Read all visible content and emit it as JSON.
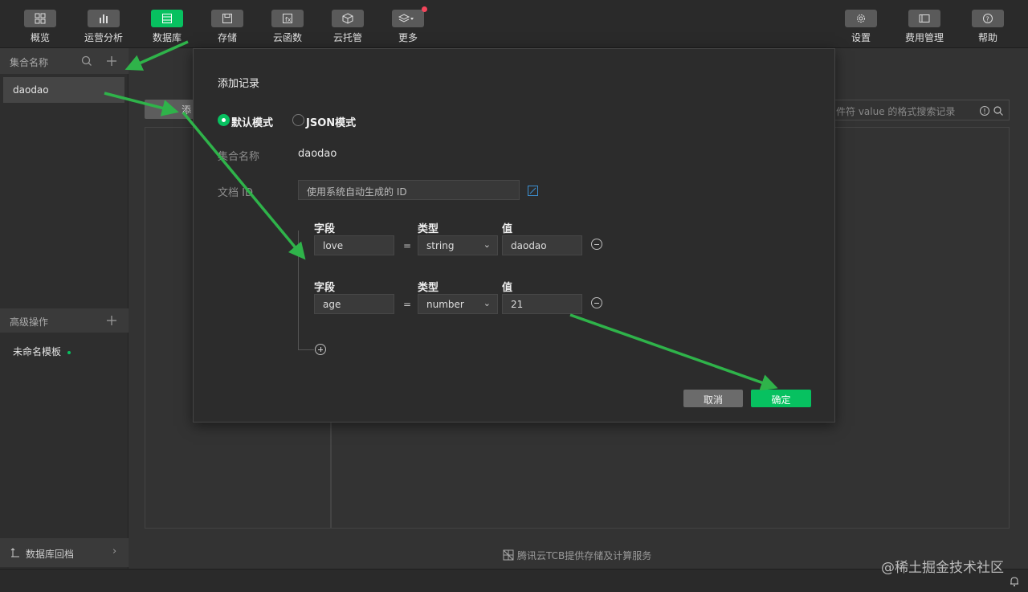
{
  "toolbar": {
    "left": [
      {
        "label": "概览",
        "icon": "grid-icon",
        "active": false
      },
      {
        "label": "运营分析",
        "icon": "bar-chart-icon",
        "active": false
      },
      {
        "label": "数据库",
        "icon": "database-icon",
        "active": true
      },
      {
        "label": "存储",
        "icon": "floppy-icon",
        "active": false
      },
      {
        "label": "云函数",
        "icon": "function-icon",
        "active": false
      },
      {
        "label": "云托管",
        "icon": "cube-icon",
        "active": false
      },
      {
        "label": "更多",
        "icon": "layers-icon",
        "active": false
      }
    ],
    "right": [
      {
        "label": "设置",
        "icon": "gear-icon"
      },
      {
        "label": "费用管理",
        "icon": "card-icon"
      },
      {
        "label": "帮助",
        "icon": "help-icon"
      }
    ]
  },
  "sidebar": {
    "collections_title": "集合名称",
    "collections": [
      {
        "name": "daodao"
      }
    ],
    "advanced_title": "高级操作",
    "advanced_items": [
      {
        "name": "未命名模板"
      }
    ],
    "bottom_label": "数据库回档"
  },
  "main": {
    "add_button_label": "添",
    "search_placeholder": "件符 value 的格式搜索记录"
  },
  "modal": {
    "title": "添加记录",
    "modes": [
      {
        "label": "默认模式",
        "selected": true
      },
      {
        "label": "JSON模式",
        "selected": false
      }
    ],
    "collection_label": "集合名称",
    "collection_value": "daodao",
    "doc_id_label": "文档 ID",
    "doc_id_placeholder": "使用系统自动生成的 ID",
    "field_header": "字段",
    "type_header": "类型",
    "value_header": "值",
    "fields": [
      {
        "field": "love",
        "eq": "=",
        "type": "string",
        "value": "daodao"
      },
      {
        "field": "age",
        "eq": "=",
        "type": "number",
        "value": "21"
      }
    ],
    "cancel_label": "取消",
    "confirm_label": "确定"
  },
  "footer": {
    "provider_note": "腾讯云TCB提供存储及计算服务",
    "watermark": "@稀土掘金技术社区"
  },
  "colors": {
    "accent": "#07c160",
    "arrow": "#2fb34a",
    "badge": "#f5455b"
  }
}
